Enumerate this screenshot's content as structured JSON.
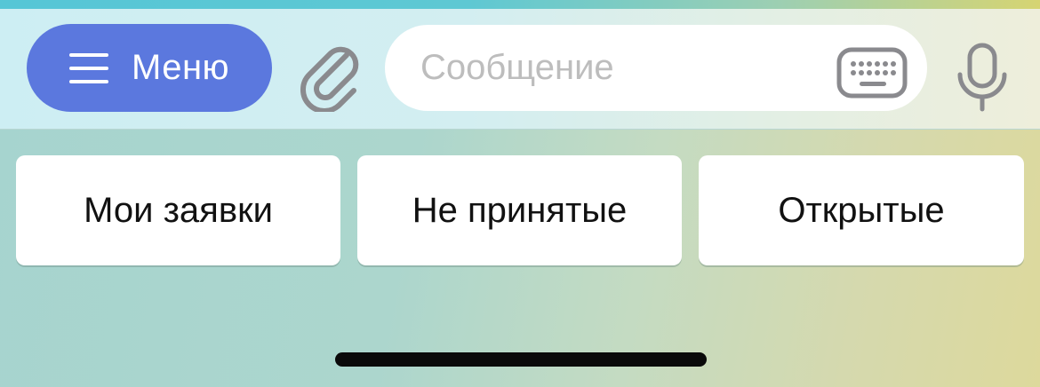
{
  "composer": {
    "menu_label": "Меню",
    "message_placeholder": "Сообщение",
    "message_value": ""
  },
  "icons": {
    "menu": "hamburger-icon",
    "attach": "paperclip-icon",
    "keyboard": "keyboard-icon",
    "voice": "microphone-icon"
  },
  "reply_keyboard": {
    "buttons": [
      {
        "label": "Мои заявки"
      },
      {
        "label": "Не принятые"
      },
      {
        "label": "Открытые"
      }
    ]
  },
  "colors": {
    "menu_button": "#5b78de",
    "icon_gray": "#8a8a8e",
    "home_indicator": "#0a0a0a"
  }
}
